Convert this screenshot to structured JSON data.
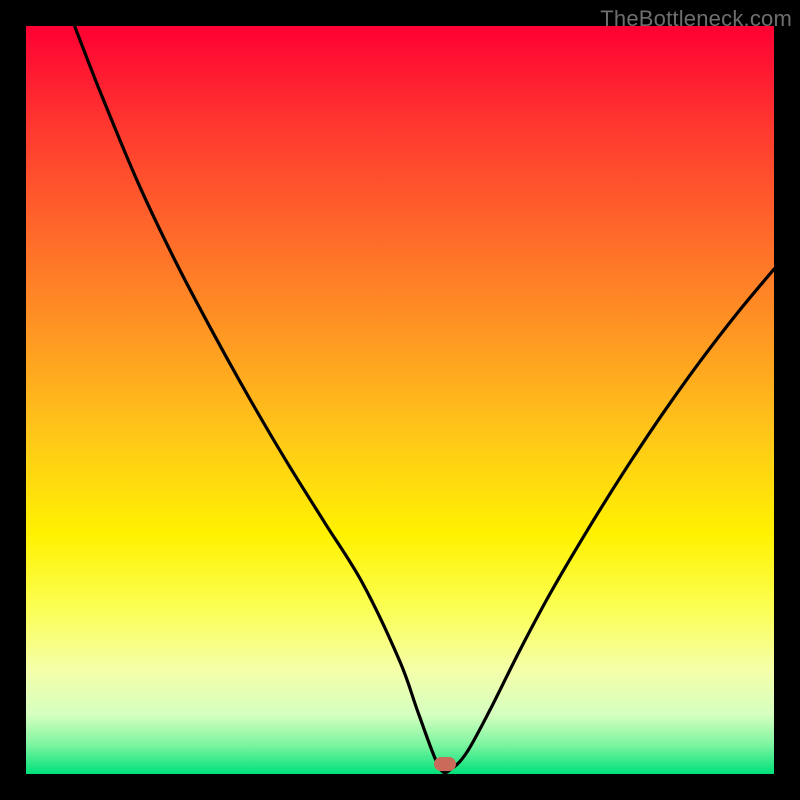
{
  "watermark": "TheBottleneck.com",
  "chart_data": {
    "type": "line",
    "title": "",
    "xlabel": "",
    "ylabel": "",
    "xlim": [
      0,
      100
    ],
    "ylim": [
      0,
      100
    ],
    "series": [
      {
        "name": "curve",
        "x": [
          6.5,
          10,
          15,
          20,
          25,
          30,
          35,
          40,
          45,
          50,
          52.5,
          55.3,
          57,
          59,
          62,
          66,
          70,
          75,
          80,
          85,
          90,
          95,
          100
        ],
        "y": [
          100,
          91,
          79,
          68.5,
          59,
          50,
          41.5,
          33.5,
          25.5,
          15,
          8,
          0.8,
          0.8,
          3,
          8.5,
          16.5,
          24,
          32.5,
          40.5,
          48,
          55,
          61.5,
          67.5
        ]
      }
    ],
    "marker": {
      "x": 56,
      "y": 1.3
    },
    "gradient_stops": [
      {
        "pct": 0,
        "color": "#ff0033"
      },
      {
        "pct": 14,
        "color": "#ff3a2f"
      },
      {
        "pct": 28,
        "color": "#ff6a2a"
      },
      {
        "pct": 42,
        "color": "#ff9a22"
      },
      {
        "pct": 55,
        "color": "#ffc818"
      },
      {
        "pct": 68,
        "color": "#fff200"
      },
      {
        "pct": 78,
        "color": "#fbff55"
      },
      {
        "pct": 86,
        "color": "#f5ffa8"
      },
      {
        "pct": 92,
        "color": "#d6ffc0"
      },
      {
        "pct": 96,
        "color": "#7ff5a0"
      },
      {
        "pct": 100,
        "color": "#00e07a"
      }
    ]
  }
}
